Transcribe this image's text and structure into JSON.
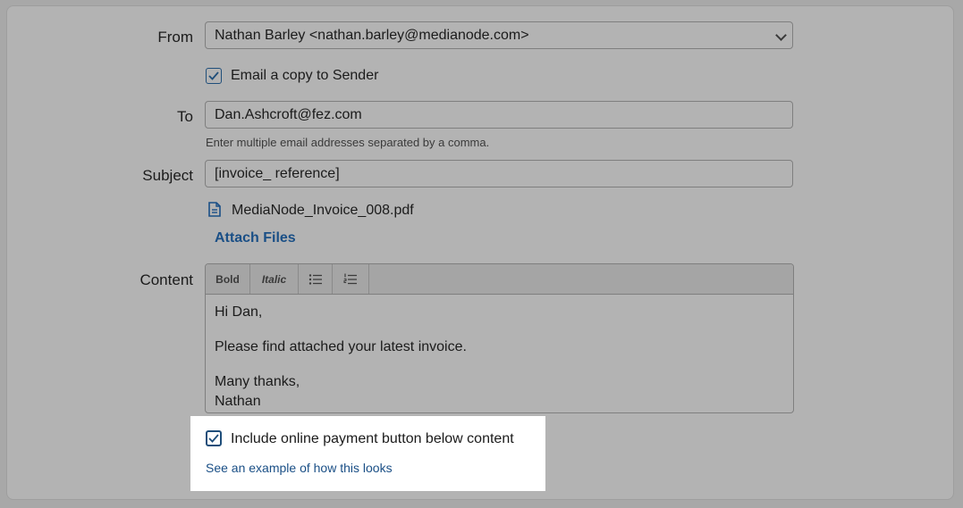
{
  "form": {
    "from": {
      "label": "From",
      "value": "Nathan Barley <nathan.barley@medianode.com>"
    },
    "email_copy": {
      "label": "Email a copy to Sender",
      "checked": true
    },
    "to": {
      "label": "To",
      "value": "Dan.Ashcroft@fez.com",
      "hint": "Enter multiple email addresses separated by a comma."
    },
    "subject": {
      "label": "Subject",
      "value": "[invoice_ reference]"
    },
    "attachment": {
      "filename": "MediaNode_Invoice_008.pdf",
      "icon": "document-icon"
    },
    "attach_files_label": "Attach Files",
    "content": {
      "label": "Content",
      "toolbar": {
        "bold": "Bold",
        "italic": "Italic",
        "bullet_icon": "bulleted-list-icon",
        "number_icon": "numbered-list-icon"
      },
      "lines": {
        "greeting": "Hi Dan,",
        "body": "Please find attached your latest invoice.",
        "signoff1": "Many thanks,",
        "signoff2": "Nathan"
      }
    },
    "payment": {
      "label": "Include online payment button below content",
      "checked": true,
      "example_link": "See an example of how this looks"
    }
  },
  "colors": {
    "checkbox_accent": "#1f4e7a",
    "link": "#1a4f86",
    "highlight": "#ffffff"
  }
}
